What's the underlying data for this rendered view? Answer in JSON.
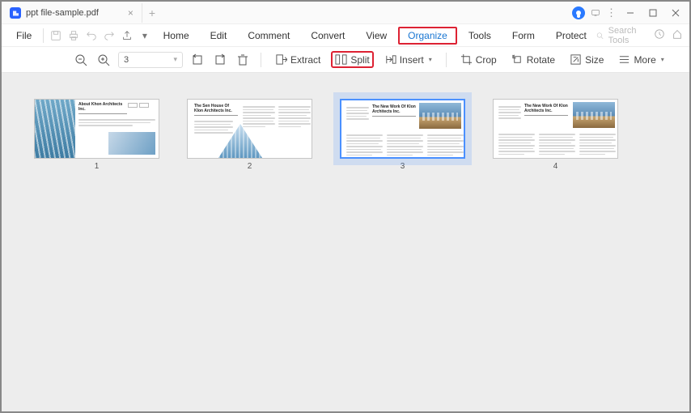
{
  "tab": {
    "filename": "ppt file-sample.pdf"
  },
  "menu": {
    "file": "File",
    "tabs": [
      "Home",
      "Edit",
      "Comment",
      "Convert",
      "View",
      "Organize",
      "Tools",
      "Form",
      "Protect"
    ],
    "active_index": 5,
    "search_placeholder": "Search Tools"
  },
  "toolbar": {
    "page_value": "3",
    "extract": "Extract",
    "split": "Split",
    "insert": "Insert",
    "crop": "Crop",
    "rotate": "Rotate",
    "size": "Size",
    "more": "More"
  },
  "thumbnails": {
    "selected": 3,
    "pages": [
      {
        "n": "1",
        "title": "About Khon Architects Inc."
      },
      {
        "n": "2",
        "title": "The Sen House Of Klon Architects Inc."
      },
      {
        "n": "3",
        "title": "The New Work Of Klon Architects Inc."
      },
      {
        "n": "4",
        "title": "The New Work Of Klon Architects Inc."
      }
    ]
  },
  "highlights": {
    "menu_organize": true,
    "toolbar_split": true
  }
}
